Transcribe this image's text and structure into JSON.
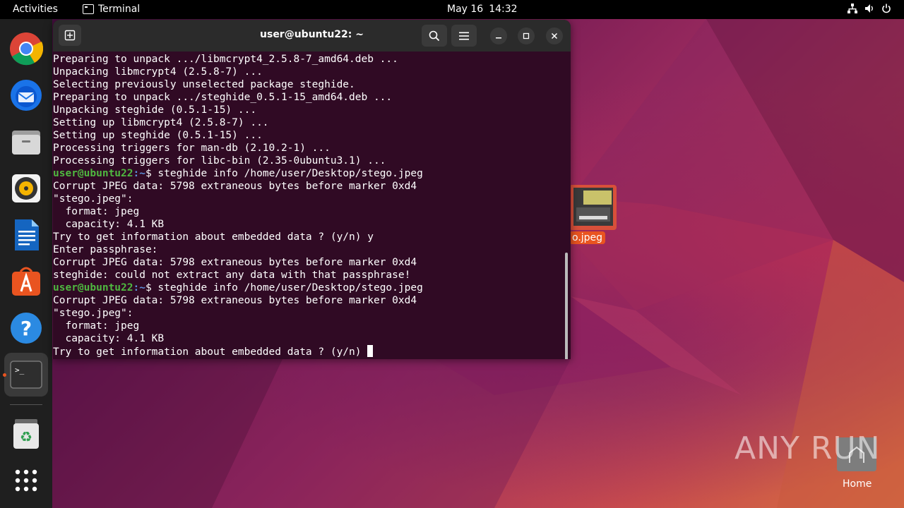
{
  "topbar": {
    "activities": "Activities",
    "app_name": "Terminal",
    "date": "May 16",
    "time": "14:32",
    "tray_icons": [
      "network-icon",
      "volume-icon",
      "power-icon"
    ]
  },
  "dock": {
    "items": [
      {
        "name": "chrome-icon"
      },
      {
        "name": "thunderbird-icon"
      },
      {
        "name": "files-icon"
      },
      {
        "name": "rhythmbox-icon"
      },
      {
        "name": "libreoffice-writer-icon"
      },
      {
        "name": "app-center-icon"
      },
      {
        "name": "help-icon"
      },
      {
        "name": "terminal-icon"
      },
      {
        "name": "trash-icon"
      },
      {
        "name": "show-apps-icon"
      }
    ]
  },
  "desktop": {
    "file_label": "o.jpeg",
    "home_label": "Home",
    "watermark": "ANY RUN"
  },
  "terminal": {
    "title": "user@ubuntu22: ~",
    "prompt_user": "user@ubuntu22",
    "prompt_sep": ":~",
    "lines": [
      "Preparing to unpack .../libmcrypt4_2.5.8-7_amd64.deb ...",
      "Unpacking libmcrypt4 (2.5.8-7) ...",
      "Selecting previously unselected package steghide.",
      "Preparing to unpack .../steghide_0.5.1-15_amd64.deb ...",
      "Unpacking steghide (0.5.1-15) ...",
      "Setting up libmcrypt4 (2.5.8-7) ...",
      "Setting up steghide (0.5.1-15) ...",
      "Processing triggers for man-db (2.10.2-1) ...",
      "Processing triggers for libc-bin (2.35-0ubuntu3.1) ..."
    ],
    "cmd1": "$ steghide info /home/user/Desktop/stego.jpeg",
    "out1": [
      "Corrupt JPEG data: 5798 extraneous bytes before marker 0xd4",
      "\"stego.jpeg\":",
      "  format: jpeg",
      "  capacity: 4.1 KB",
      "Try to get information about embedded data ? (y/n) y",
      "Enter passphrase:",
      "Corrupt JPEG data: 5798 extraneous bytes before marker 0xd4",
      "steghide: could not extract any data with that passphrase!"
    ],
    "cmd2": "$ steghide info /home/user/Desktop/stego.jpeg",
    "out2": [
      "Corrupt JPEG data: 5798 extraneous bytes before marker 0xd4",
      "\"stego.jpeg\":",
      "  format: jpeg",
      "  capacity: 4.1 KB"
    ],
    "last_line": "Try to get information about embedded data ? (y/n) "
  },
  "colors": {
    "terminal_bg": "#300a24",
    "prompt_user": "#4fb840",
    "prompt_path": "#5b8fd9",
    "accent": "#e95420"
  }
}
